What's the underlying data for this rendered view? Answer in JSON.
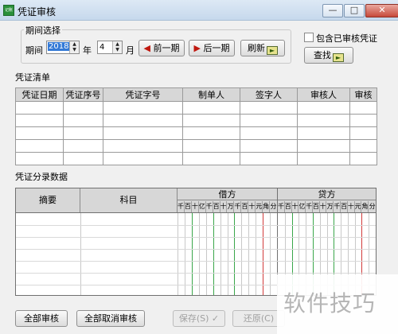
{
  "window": {
    "title": "凭证审核",
    "icon_text": "记账",
    "min_glyph": "—",
    "max_glyph": "□",
    "close_glyph": "✕"
  },
  "period": {
    "group_title": "期间选择",
    "period_label": "期间",
    "year_value": "2018",
    "year_label": "年",
    "month_value": "4",
    "month_label": "月",
    "prev_label": "前一期",
    "next_label": "后一期",
    "refresh_label": "刷新",
    "prev_icon": "arrow-left-icon",
    "next_icon": "arrow-right-icon",
    "spin_up": "▲",
    "spin_down": "▼",
    "left_arrow": "◀",
    "right_arrow": "▶",
    "go_glyph": "►",
    "accent": "#c0180f"
  },
  "options": {
    "include_audited_label": "包含已审核凭证",
    "include_audited_checked": false,
    "find_label": "查找"
  },
  "voucher_list": {
    "title": "凭证清单",
    "columns": [
      "凭证日期",
      "凭证序号",
      "凭证字号",
      "制单人",
      "签字人",
      "审核人",
      "审核"
    ],
    "rows": [
      [
        "",
        "",
        "",
        "",
        "",
        "",
        ""
      ],
      [
        "",
        "",
        "",
        "",
        "",
        "",
        ""
      ],
      [
        "",
        "",
        "",
        "",
        "",
        "",
        ""
      ],
      [
        "",
        "",
        "",
        "",
        "",
        "",
        ""
      ],
      [
        "",
        "",
        "",
        "",
        "",
        "",
        ""
      ]
    ]
  },
  "entries": {
    "title": "凭证分录数据",
    "col_summary": "摘要",
    "col_account": "科目",
    "debit_label": "借方",
    "credit_label": "贷方",
    "digits": [
      "千",
      "百",
      "十",
      "亿",
      "千",
      "百",
      "十",
      "万",
      "千",
      "百",
      "十",
      "元",
      "角",
      "分"
    ],
    "yuan_line_color": "#d23a3a",
    "group_line_color": "#3aa64a"
  },
  "footer": {
    "audit_all_label": "全部审核",
    "cancel_all_label": "全部取消审核",
    "save_label": "保存(S)",
    "restore_label": "还原(C)",
    "check_glyph": "✓"
  },
  "watermark": {
    "text": "软件技巧"
  }
}
